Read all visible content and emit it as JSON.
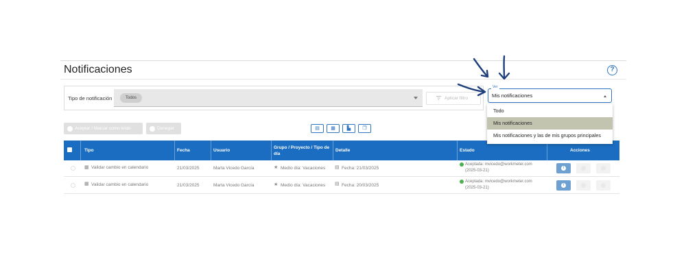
{
  "page": {
    "title": "Notificaciones",
    "help_icon": "question-circle-icon"
  },
  "filter": {
    "label": "Tipo de notificación",
    "chip": "Todos",
    "apply_label": "Aplicar filtro"
  },
  "ver": {
    "label": "Ver",
    "value": "Mis notificaciones",
    "options": [
      "Todo",
      "Mis notificaciones",
      "Mis notificaciones y las de mis grupos principales"
    ],
    "selected_index": 1
  },
  "toolbar": {
    "accept_label": "Aceptar / Marcar como leído",
    "deny_label": "Denegar",
    "export_icons": [
      "pdf-icon",
      "excel-icon",
      "csv-icon",
      "copy-icon"
    ]
  },
  "table": {
    "headers": [
      "Tipo",
      "Fecha",
      "Usuario",
      "Grupo / Proyecto / Tipo de día",
      "Detalle",
      "Estado",
      "Acciones"
    ],
    "rows": [
      {
        "tipo": "Validar cambio en calendario",
        "fecha": "21/03/2025",
        "usuario": "Marta Vicedo García",
        "grupo": "Medio día: Vacaciones",
        "detalle": "Fecha: 21/03/2025",
        "estado_line1": "Aceptada: mvicedo@workmeter.com",
        "estado_line2": "(2025-03-21)"
      },
      {
        "tipo": "Validar cambio en calendario",
        "fecha": "21/03/2025",
        "usuario": "Marta Vicedo García",
        "grupo": "Medio día: Vacaciones",
        "detalle": "Fecha: 20/03/2025",
        "estado_line1": "Aceptada: mvicedo@workmeter.com",
        "estado_line2": "(2025-03-21)"
      }
    ]
  },
  "colors": {
    "accent": "#1a6dc1",
    "ver_border": "#2f74c0",
    "annotation_arrows": "#1f3f7a",
    "selected_option": "#c3c4b0"
  }
}
